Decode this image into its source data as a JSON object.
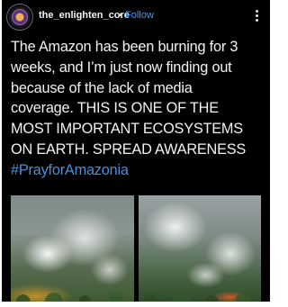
{
  "post": {
    "username": "the_enlighten_core",
    "separator": "•",
    "follow_label": "Follow",
    "more_icon": "more-vertical-icon",
    "caption_lines": [
      "The Amazon has been burning for 3",
      "weeks, and I’m just now finding out",
      "because of the lack of media",
      "coverage. THIS IS ONE OF THE",
      "MOST IMPORTANT ECOSYSTEMS",
      "ON EARTH. SPREAD AWARENESS"
    ],
    "hashtag": "#PrayforAmazonia",
    "colors": {
      "background": "#000000",
      "text": "#f2f2f2",
      "follow": "#3b9cf5",
      "hashtag": "#4a8fd8"
    }
  }
}
